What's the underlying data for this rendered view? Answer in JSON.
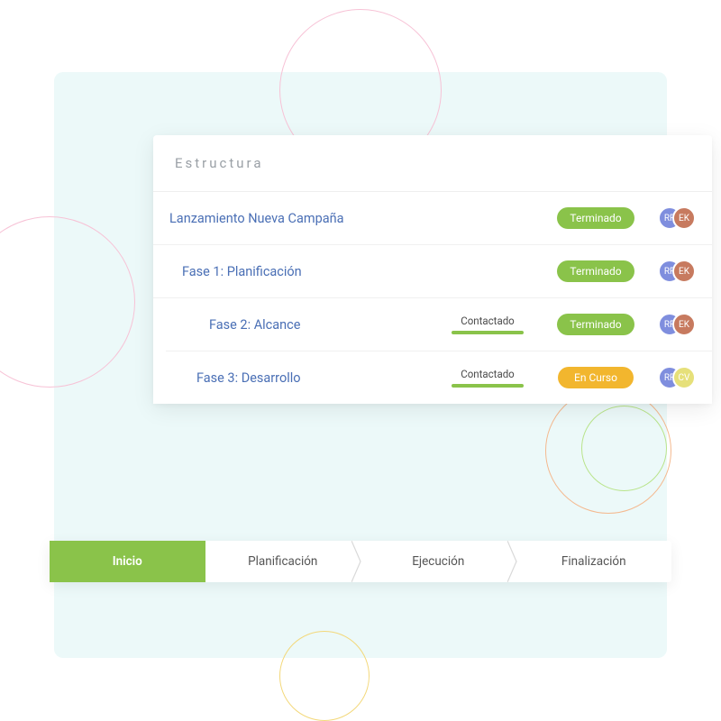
{
  "header": {
    "title": "Estructura"
  },
  "statuses": {
    "done": "Terminado",
    "in_progress": "En Curso"
  },
  "contact_label": "Contactado",
  "rows": [
    {
      "title": "Lanzamiento Nueva Campaña",
      "status": "done",
      "avatars": [
        "RR",
        "EK"
      ]
    },
    {
      "title": "Fase 1: Planificación",
      "status": "done",
      "avatars": [
        "RR",
        "EK"
      ]
    },
    {
      "title": "Fase 2: Alcance",
      "contact": true,
      "status": "done",
      "avatars": [
        "RR",
        "EK"
      ]
    },
    {
      "title": "Fase 3: Desarrollo",
      "contact": true,
      "status": "in_progress",
      "avatars": [
        "RR",
        "CV"
      ]
    }
  ],
  "stages": [
    "Inicio",
    "Planificación",
    "Ejecución",
    "Finalización"
  ],
  "active_stage": 0,
  "colors": {
    "green": "#8ac34a",
    "orange": "#f2b62e",
    "avatar_blue": "#7f8ede",
    "avatar_brown": "#c77a5f",
    "avatar_yellow": "#e6e07a"
  }
}
